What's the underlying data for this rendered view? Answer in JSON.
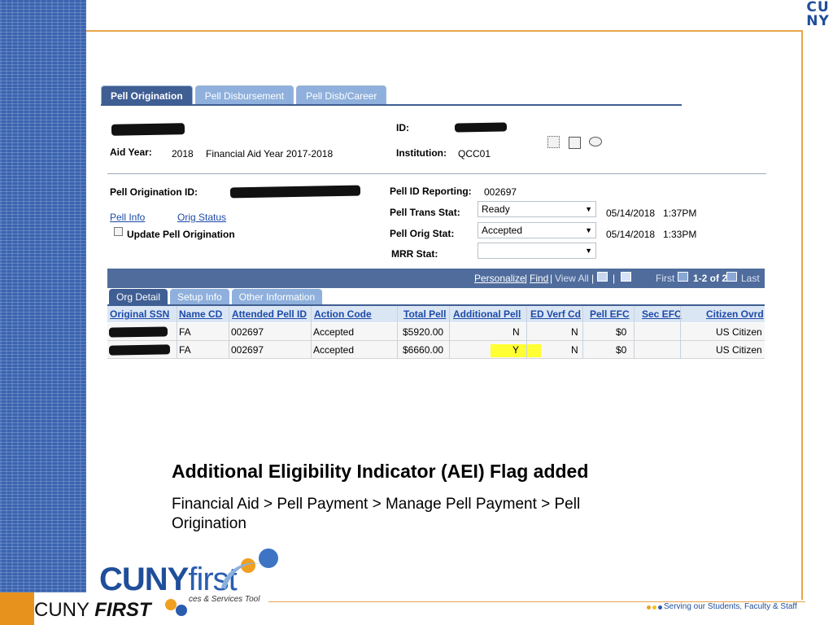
{
  "brand": {
    "top_logo": "CU\nNY"
  },
  "tabs": [
    "Pell Origination",
    "Pell Disbursement",
    "Pell Disb/Career"
  ],
  "header": {
    "aid_year_label": "Aid Year:",
    "aid_year_value": "2018",
    "aid_year_desc": "Financial Aid Year 2017-2018",
    "id_label": "ID:",
    "institution_label": "Institution:",
    "institution_value": "QCC01"
  },
  "origination": {
    "id_label": "Pell Origination ID:",
    "pell_info_link": "Pell Info",
    "orig_status_link": "Orig Status",
    "update_label": "Update Pell Origination",
    "reporting_label": "Pell ID Reporting:",
    "reporting_value": "002697",
    "trans_stat_label": "Pell Trans Stat:",
    "trans_stat_value": "Ready",
    "trans_stat_date": "05/14/2018",
    "trans_stat_time": "1:37PM",
    "orig_stat_label": "Pell Orig Stat:",
    "orig_stat_value": "Accepted",
    "orig_stat_date": "05/14/2018",
    "orig_stat_time": "1:33PM",
    "mrr_stat_label": "MRR Stat:"
  },
  "grid": {
    "personalize": "Personalize",
    "find": "Find",
    "view_all": "View All",
    "first": "First",
    "range": "1-2 of 2",
    "last": "Last",
    "sub_tabs": [
      "Org Detail",
      "Setup Info",
      "Other Information"
    ],
    "columns": [
      "Original SSN",
      "Name CD",
      "Attended Pell ID",
      "Action Code",
      "Total Pell",
      "Additional Pell",
      "ED Verf Cd",
      "Pell EFC",
      "Sec EFC",
      "Citizen Ovrd"
    ],
    "rows": [
      {
        "name_cd": "FA",
        "attended": "002697",
        "action": "Accepted",
        "total": "$5920.00",
        "additional": "N",
        "ed_verf": "N",
        "efc": "$0",
        "sec_efc": "",
        "citizen": "US Citizen"
      },
      {
        "name_cd": "FA",
        "attended": "002697",
        "action": "Accepted",
        "total": "$6660.00",
        "additional": "Y",
        "ed_verf": "N",
        "efc": "$0",
        "sec_efc": "",
        "citizen": "US Citizen"
      }
    ]
  },
  "caption": {
    "title": "Additional Eligibility Indicator (AEI) Flag added",
    "path": "Financial Aid > Pell Payment > Manage Pell Payment > Pell Origination"
  },
  "footer": {
    "cuny": "CUNY",
    "first": "first",
    "sub": "ces & Services Tool",
    "brand_cuny": "CUNY",
    "brand_first": "FIRST",
    "serving": "Serving our Students, Faculty & Staff"
  },
  "colors": {
    "accent": "#3f5e93",
    "highlight": "#ffff33",
    "rule": "#e8a54a"
  }
}
